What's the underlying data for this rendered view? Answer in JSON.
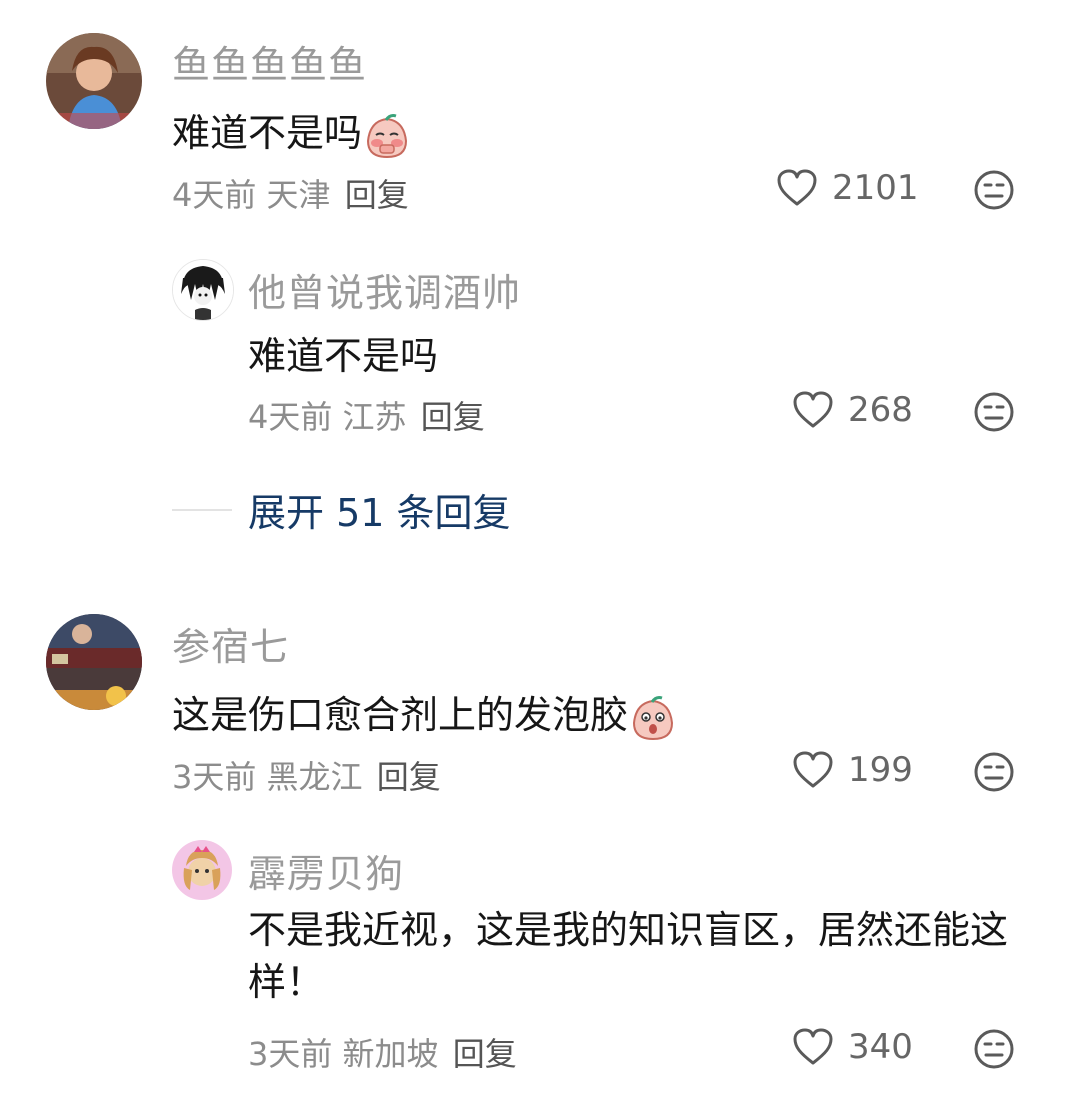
{
  "comments": [
    {
      "username": "鱼鱼鱼鱼鱼",
      "text": "难道不是吗",
      "emoji": "blush-peach-emoji",
      "time": "4天前",
      "location": "天津",
      "reply_label": "回复",
      "likes": "2101",
      "replies": [
        {
          "username": "他曾说我调酒帅",
          "text": "难道不是吗",
          "time": "4天前",
          "location": "江苏",
          "reply_label": "回复",
          "likes": "268"
        }
      ],
      "expand_label": "展开 51 条回复"
    },
    {
      "username": "参宿七",
      "text": "这是伤口愈合剂上的发泡胶",
      "emoji": "surprised-peach-emoji",
      "time": "3天前",
      "location": "黑龙江",
      "reply_label": "回复",
      "likes": "199",
      "replies": [
        {
          "username": "霹雳贝狗",
          "text": "不是我近视，这是我的知识盲区，居然还能这样！",
          "time": "3天前",
          "location": "新加坡",
          "reply_label": "回复",
          "likes": "340"
        }
      ]
    }
  ],
  "colors": {
    "username": "#9a9a9a",
    "text": "#161616",
    "meta": "#8c8c8c",
    "expand": "#163a66"
  },
  "icons": [
    "heart-outline-icon",
    "dislike-face-icon"
  ]
}
